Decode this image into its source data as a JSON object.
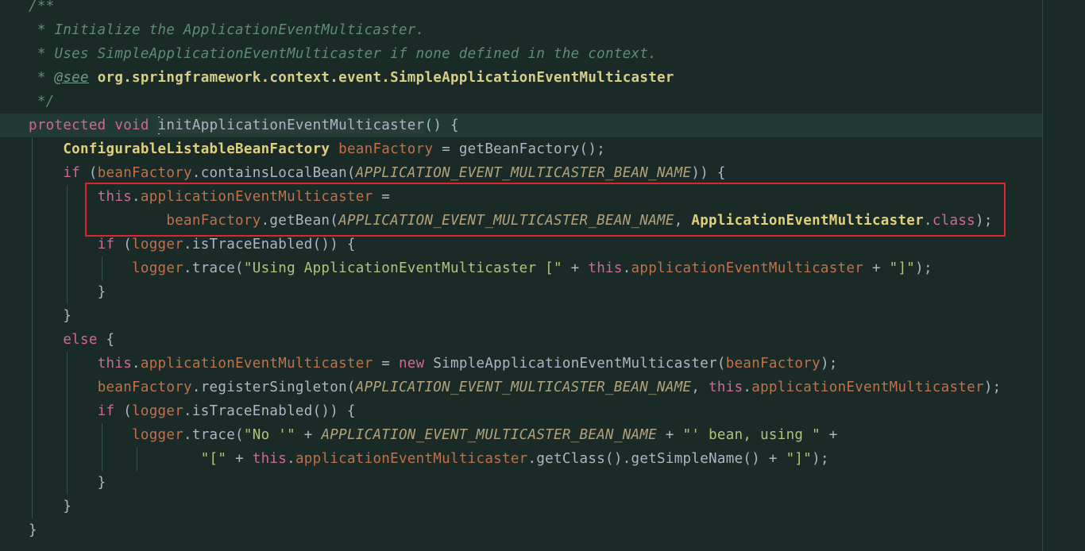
{
  "editor": {
    "lines": [
      {
        "id": "l1",
        "segments": [
          {
            "cls": "doc",
            "text": "/**"
          }
        ]
      },
      {
        "id": "l2",
        "segments": [
          {
            "cls": "doc",
            "text": " * Initialize the ApplicationEventMulticaster."
          }
        ]
      },
      {
        "id": "l3",
        "segments": [
          {
            "cls": "doc",
            "text": " * Uses SimpleApplicationEventMulticaster if none defined in the context."
          }
        ]
      },
      {
        "id": "l4",
        "segments": [
          {
            "cls": "doc",
            "text": " * "
          },
          {
            "cls": "tag",
            "text": "@see"
          },
          {
            "cls": "doc",
            "text": " "
          },
          {
            "cls": "ref",
            "text": "org.springframework.context.event.SimpleApplicationEventMulticaster"
          }
        ]
      },
      {
        "id": "l5",
        "segments": [
          {
            "cls": "doc",
            "text": " */"
          }
        ]
      },
      {
        "id": "l6",
        "segments": [
          {
            "cls": "k",
            "text": "protected"
          },
          {
            "cls": "pn",
            "text": " "
          },
          {
            "cls": "k",
            "text": "void"
          },
          {
            "cls": "pn",
            "text": " "
          },
          {
            "cls": "caret",
            "text": ""
          },
          {
            "cls": "fn method-hl",
            "text": "initApplicationEventMulticaster"
          },
          {
            "cls": "pn",
            "text": "() {"
          }
        ]
      },
      {
        "id": "l7",
        "segments": [
          {
            "cls": "pn",
            "text": "    "
          },
          {
            "cls": "ty",
            "text": "ConfigurableListableBeanFactory"
          },
          {
            "cls": "pn",
            "text": " "
          },
          {
            "cls": "fld",
            "text": "beanFactory"
          },
          {
            "cls": "pn",
            "text": " = getBeanFactory();"
          }
        ]
      },
      {
        "id": "l8",
        "segments": [
          {
            "cls": "pn",
            "text": "    "
          },
          {
            "cls": "k",
            "text": "if"
          },
          {
            "cls": "pn",
            "text": " ("
          },
          {
            "cls": "fld",
            "text": "beanFactory"
          },
          {
            "cls": "pn",
            "text": ".containsLocalBean("
          },
          {
            "cls": "cst",
            "text": "APPLICATION_EVENT_MULTICASTER_BEAN_NAME"
          },
          {
            "cls": "pn",
            "text": ")) {"
          }
        ]
      },
      {
        "id": "l9",
        "segments": [
          {
            "cls": "pn",
            "text": "        "
          },
          {
            "cls": "k",
            "text": "this"
          },
          {
            "cls": "pn",
            "text": "."
          },
          {
            "cls": "fld",
            "text": "applicationEventMulticaster"
          },
          {
            "cls": "pn",
            "text": " ="
          }
        ]
      },
      {
        "id": "l10",
        "segments": [
          {
            "cls": "pn",
            "text": "                "
          },
          {
            "cls": "fld",
            "text": "beanFactory"
          },
          {
            "cls": "pn",
            "text": ".getBean("
          },
          {
            "cls": "cst",
            "text": "APPLICATION_EVENT_MULTICASTER_BEAN_NAME"
          },
          {
            "cls": "pn",
            "text": ", "
          },
          {
            "cls": "ty",
            "text": "ApplicationEventMulticaster"
          },
          {
            "cls": "pn",
            "text": "."
          },
          {
            "cls": "k",
            "text": "class"
          },
          {
            "cls": "pn",
            "text": ");"
          }
        ]
      },
      {
        "id": "l11",
        "segments": [
          {
            "cls": "pn",
            "text": "        "
          },
          {
            "cls": "k",
            "text": "if"
          },
          {
            "cls": "pn",
            "text": " ("
          },
          {
            "cls": "fld",
            "text": "logger"
          },
          {
            "cls": "pn",
            "text": ".isTraceEnabled()) {"
          }
        ]
      },
      {
        "id": "l12",
        "segments": [
          {
            "cls": "pn",
            "text": "            "
          },
          {
            "cls": "fld",
            "text": "logger"
          },
          {
            "cls": "pn",
            "text": ".trace("
          },
          {
            "cls": "str",
            "text": "\"Using ApplicationEventMulticaster [\""
          },
          {
            "cls": "pn",
            "text": " + "
          },
          {
            "cls": "k",
            "text": "this"
          },
          {
            "cls": "pn",
            "text": "."
          },
          {
            "cls": "fld",
            "text": "applicationEventMulticaster"
          },
          {
            "cls": "pn",
            "text": " + "
          },
          {
            "cls": "str",
            "text": "\"]\""
          },
          {
            "cls": "pn",
            "text": ");"
          }
        ]
      },
      {
        "id": "l13",
        "segments": [
          {
            "cls": "pn",
            "text": "        }"
          }
        ]
      },
      {
        "id": "l14",
        "segments": [
          {
            "cls": "pn",
            "text": "    }"
          }
        ]
      },
      {
        "id": "l15",
        "segments": [
          {
            "cls": "pn",
            "text": "    "
          },
          {
            "cls": "k",
            "text": "else"
          },
          {
            "cls": "pn",
            "text": " {"
          }
        ]
      },
      {
        "id": "l16",
        "segments": [
          {
            "cls": "pn",
            "text": "        "
          },
          {
            "cls": "k",
            "text": "this"
          },
          {
            "cls": "pn",
            "text": "."
          },
          {
            "cls": "fld",
            "text": "applicationEventMulticaster"
          },
          {
            "cls": "pn",
            "text": " = "
          },
          {
            "cls": "k",
            "text": "new"
          },
          {
            "cls": "pn",
            "text": " SimpleApplicationEventMulticaster("
          },
          {
            "cls": "fld",
            "text": "beanFactory"
          },
          {
            "cls": "pn",
            "text": ");"
          }
        ]
      },
      {
        "id": "l17",
        "segments": [
          {
            "cls": "pn",
            "text": "        "
          },
          {
            "cls": "fld",
            "text": "beanFactory"
          },
          {
            "cls": "pn",
            "text": ".registerSingleton("
          },
          {
            "cls": "cst",
            "text": "APPLICATION_EVENT_MULTICASTER_BEAN_NAME"
          },
          {
            "cls": "pn",
            "text": ", "
          },
          {
            "cls": "k",
            "text": "this"
          },
          {
            "cls": "pn",
            "text": "."
          },
          {
            "cls": "fld",
            "text": "applicationEventMulticaster"
          },
          {
            "cls": "pn",
            "text": ");"
          }
        ]
      },
      {
        "id": "l18",
        "segments": [
          {
            "cls": "pn",
            "text": "        "
          },
          {
            "cls": "k",
            "text": "if"
          },
          {
            "cls": "pn",
            "text": " ("
          },
          {
            "cls": "fld",
            "text": "logger"
          },
          {
            "cls": "pn",
            "text": ".isTraceEnabled()) {"
          }
        ]
      },
      {
        "id": "l19",
        "segments": [
          {
            "cls": "pn",
            "text": "            "
          },
          {
            "cls": "fld",
            "text": "logger"
          },
          {
            "cls": "pn",
            "text": ".trace("
          },
          {
            "cls": "str",
            "text": "\"No '\""
          },
          {
            "cls": "pn",
            "text": " + "
          },
          {
            "cls": "cst",
            "text": "APPLICATION_EVENT_MULTICASTER_BEAN_NAME"
          },
          {
            "cls": "pn",
            "text": " + "
          },
          {
            "cls": "str",
            "text": "\"' bean, using \""
          },
          {
            "cls": "pn",
            "text": " +"
          }
        ]
      },
      {
        "id": "l20",
        "segments": [
          {
            "cls": "pn",
            "text": "                    "
          },
          {
            "cls": "str",
            "text": "\"[\""
          },
          {
            "cls": "pn",
            "text": " + "
          },
          {
            "cls": "k",
            "text": "this"
          },
          {
            "cls": "pn",
            "text": "."
          },
          {
            "cls": "fld",
            "text": "applicationEventMulticaster"
          },
          {
            "cls": "pn",
            "text": ".getClass().getSimpleName() + "
          },
          {
            "cls": "str",
            "text": "\"]\""
          },
          {
            "cls": "pn",
            "text": ");"
          }
        ]
      },
      {
        "id": "l21",
        "segments": [
          {
            "cls": "pn",
            "text": "        }"
          }
        ]
      },
      {
        "id": "l22",
        "segments": [
          {
            "cls": "pn",
            "text": "    }"
          }
        ]
      },
      {
        "id": "l23",
        "segments": [
          {
            "cls": "pn",
            "text": "}"
          }
        ]
      }
    ]
  },
  "highlight": {
    "label": "red-highlight-box"
  }
}
